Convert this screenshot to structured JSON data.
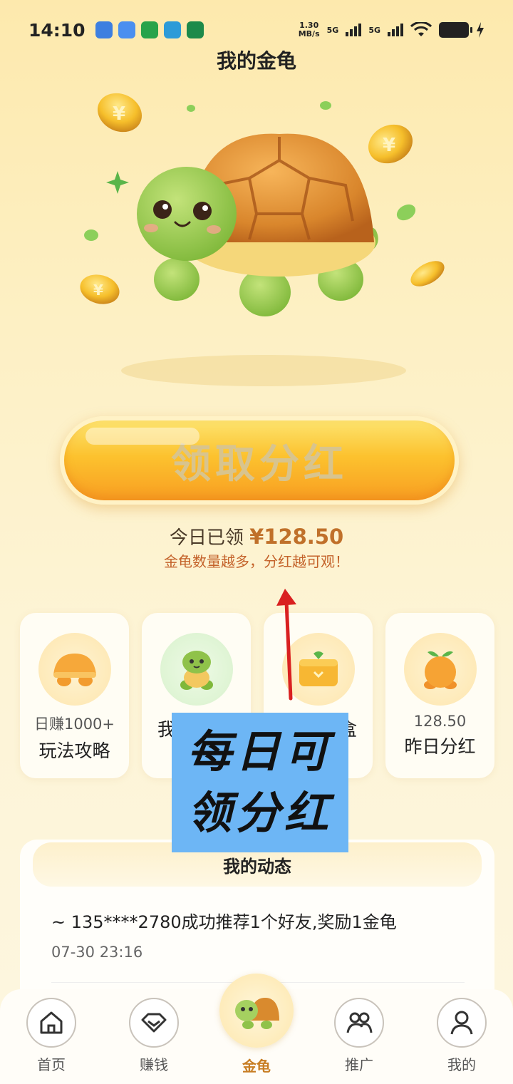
{
  "status_bar": {
    "time": "14:10",
    "netspeed_value": "1.30",
    "netspeed_unit": "MB/s",
    "sim1": "5G",
    "sim2": "5G"
  },
  "header": {
    "title": "我的金龟"
  },
  "claim": {
    "button_label": "领取分红",
    "today_label": "今日已领",
    "today_amount": "¥128.50",
    "tip": "金龟数量越多，分红越可观！"
  },
  "cards": [
    {
      "sub": "日赚1000+",
      "main": "玩法攻略",
      "icon": "turtle-shell-icon"
    },
    {
      "sub": "",
      "main": "我",
      "icon": "turtle-icon"
    },
    {
      "sub": "",
      "main": "盒",
      "icon": "gift-box-icon"
    },
    {
      "sub": "128.50",
      "main": "昨日分红",
      "icon": "orange-fruit-icon"
    }
  ],
  "overlay": {
    "line1": "每日可",
    "line2": "领分红"
  },
  "feed": {
    "title": "我的动态",
    "items": [
      {
        "text": "~ 135****2780成功推荐1个好友,奖励1金龟",
        "time": "07-30 23:16"
      }
    ]
  },
  "tabbar": [
    {
      "label": "首页",
      "icon": "home-icon"
    },
    {
      "label": "赚钱",
      "icon": "diamond-icon"
    },
    {
      "label": "金龟",
      "icon": "turtle-icon"
    },
    {
      "label": "推广",
      "icon": "users-icon"
    },
    {
      "label": "我的",
      "icon": "person-icon"
    }
  ],
  "colors": {
    "accent": "#f8a324",
    "tab_active": "#c87e24",
    "amount": "#c0702a",
    "overlay_bg": "#6db6f5"
  }
}
